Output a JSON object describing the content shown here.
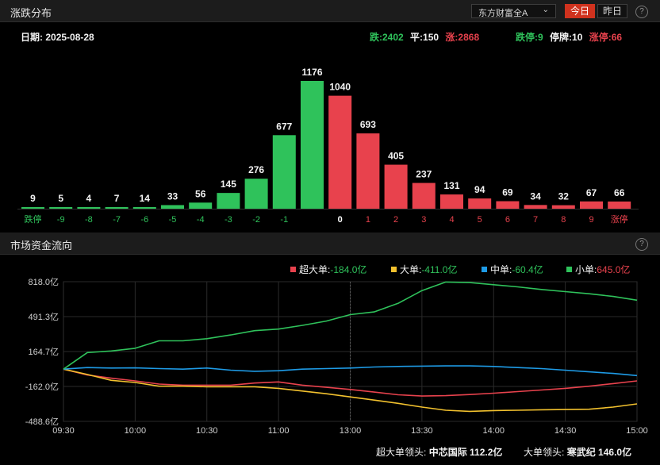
{
  "panel1": {
    "title": "涨跌分布",
    "help": "?",
    "market": "东方财富全A",
    "btn_today": "今日",
    "btn_yesterday": "昨日"
  },
  "summary": {
    "date_label": "日期:",
    "date": "2025-08-28",
    "down_label": "跌:",
    "down": "2402",
    "flat_label": "平:",
    "flat": "150",
    "up_label": "涨:",
    "up": "2868",
    "limit_down_label": "跌停:",
    "limit_down": "9",
    "suspended_label": "停牌:",
    "suspended": "10",
    "limit_up_label": "涨停:",
    "limit_up": "66"
  },
  "panel2": {
    "title": "市场资金流向",
    "help": "?"
  },
  "legend": [
    {
      "label": "超大单:",
      "value": "-184.0亿",
      "value_color": "green"
    },
    {
      "label": "大单:",
      "value": "-411.0亿",
      "value_color": "green"
    },
    {
      "label": "中单:",
      "value": "-60.4亿",
      "value_color": "green"
    },
    {
      "label": "小单:",
      "value": "645.0亿",
      "value_color": "red"
    }
  ],
  "leaders": {
    "super_label": "超大单领头:",
    "super_name": "中芯国际",
    "super_value": "112.2亿",
    "large_label": "大单领头:",
    "large_name": "寒武纪",
    "large_value": "146.0亿"
  },
  "colors": {
    "up": "#e8424d",
    "down": "#2fc25b",
    "flat": "#ffffff",
    "super": "#e8424d",
    "large": "#f2c12e",
    "medium": "#1e9be6",
    "small": "#2fc25b"
  },
  "chart_data": [
    {
      "type": "bar",
      "categories": [
        "跌停",
        "-9",
        "-8",
        "-7",
        "-6",
        "-5",
        "-4",
        "-3",
        "-2",
        "-1",
        "0",
        "1",
        "2",
        "3",
        "4",
        "5",
        "6",
        "7",
        "8",
        "9",
        "涨停"
      ],
      "values": [
        9,
        5,
        4,
        7,
        14,
        33,
        56,
        145,
        276,
        677,
        1176,
        1040,
        693,
        405,
        237,
        131,
        94,
        69,
        34,
        32,
        67,
        66
      ],
      "category_colors": [
        "down",
        "down",
        "down",
        "down",
        "down",
        "down",
        "down",
        "down",
        "down",
        "down",
        "flat",
        "up",
        "up",
        "up",
        "up",
        "up",
        "up",
        "up",
        "up",
        "up",
        "up"
      ]
    },
    {
      "type": "line",
      "x_ticks": [
        "09:30",
        "10:00",
        "10:30",
        "11:00",
        "13:00",
        "13:30",
        "14:00",
        "14:30",
        "15:00"
      ],
      "y_ticks": [
        "818.0亿",
        "491.3亿",
        "164.7亿",
        "-162.0亿",
        "-488.6亿"
      ],
      "ylim": [
        -488.6,
        818.0
      ],
      "x": [
        "09:30",
        "09:40",
        "09:50",
        "10:00",
        "10:10",
        "10:20",
        "10:30",
        "10:40",
        "10:50",
        "11:00",
        "11:10",
        "11:20",
        "11:30/13:00",
        "13:10",
        "13:20",
        "13:30",
        "13:40",
        "13:50",
        "14:00",
        "14:10",
        "14:20",
        "14:30",
        "14:40",
        "14:50",
        "15:00"
      ],
      "series": [
        {
          "name": "超大单",
          "color": "super",
          "values": [
            0,
            -55,
            -85,
            -110,
            -140,
            -150,
            -150,
            -150,
            -130,
            -120,
            -150,
            -170,
            -190,
            -215,
            -240,
            -252,
            -248,
            -238,
            -225,
            -210,
            -195,
            -180,
            -160,
            -135,
            -110
          ]
        },
        {
          "name": "大单",
          "color": "large",
          "values": [
            0,
            -50,
            -105,
            -125,
            -160,
            -160,
            -165,
            -165,
            -165,
            -180,
            -205,
            -230,
            -260,
            -290,
            -320,
            -355,
            -385,
            -395,
            -388,
            -385,
            -380,
            -378,
            -375,
            -355,
            -325
          ]
        },
        {
          "name": "中单",
          "color": "medium",
          "values": [
            0,
            15,
            10,
            12,
            5,
            0,
            10,
            -10,
            -20,
            -15,
            0,
            5,
            10,
            20,
            25,
            28,
            30,
            30,
            25,
            15,
            5,
            -10,
            -25,
            -40,
            -60
          ]
        },
        {
          "name": "小单",
          "color": "small",
          "values": [
            0,
            155,
            170,
            195,
            265,
            265,
            285,
            320,
            360,
            375,
            410,
            450,
            510,
            535,
            615,
            735,
            815,
            810,
            790,
            770,
            745,
            725,
            705,
            680,
            645
          ]
        }
      ]
    }
  ]
}
